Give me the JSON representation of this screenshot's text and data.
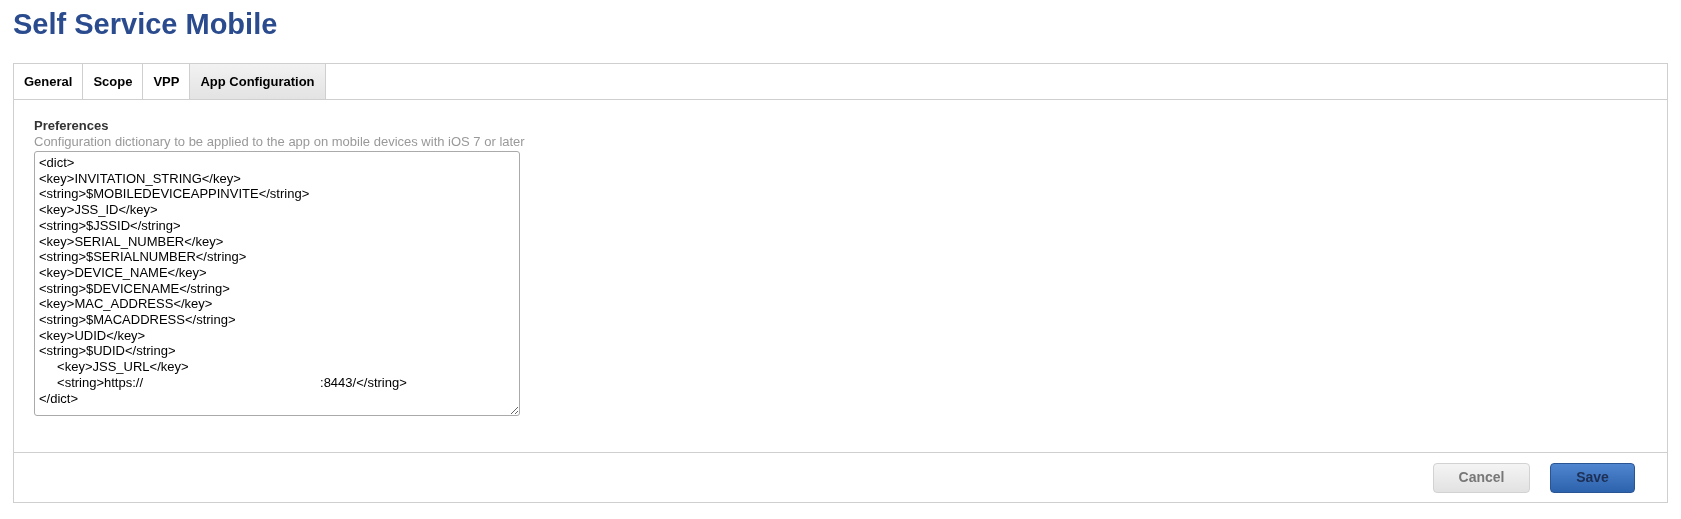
{
  "page": {
    "title": "Self Service Mobile"
  },
  "tabs": [
    {
      "label": "General",
      "selected": false
    },
    {
      "label": "Scope",
      "selected": false
    },
    {
      "label": "VPP",
      "selected": false
    },
    {
      "label": "App Configuration",
      "selected": true
    }
  ],
  "preferences": {
    "label": "Preferences",
    "hint": "Configuration dictionary to be applied to the app on mobile devices with iOS 7 or later",
    "value": [
      "<dict>",
      "<key>INVITATION_STRING</key>",
      "<string>$MOBILEDEVICEAPPINVITE</string>",
      "<key>JSS_ID</key>",
      "<string>$JSSID</string>",
      "<key>SERIAL_NUMBER</key>",
      "<string>$SERIALNUMBER</string>",
      "<key>DEVICE_NAME</key>",
      "<string>$DEVICENAME</string>",
      "<key>MAC_ADDRESS</key>",
      "<string>$MACADDRESS</string>",
      "<key>UDID</key>",
      "<string>$UDID</string>",
      "     <key>JSS_URL</key>",
      "     <string>https://                                                 :8443/</string>",
      "</dict>"
    ]
  },
  "buttons": [
    {
      "label": "Cancel",
      "kind": "secondary"
    },
    {
      "label": "Save",
      "kind": "primary"
    }
  ]
}
